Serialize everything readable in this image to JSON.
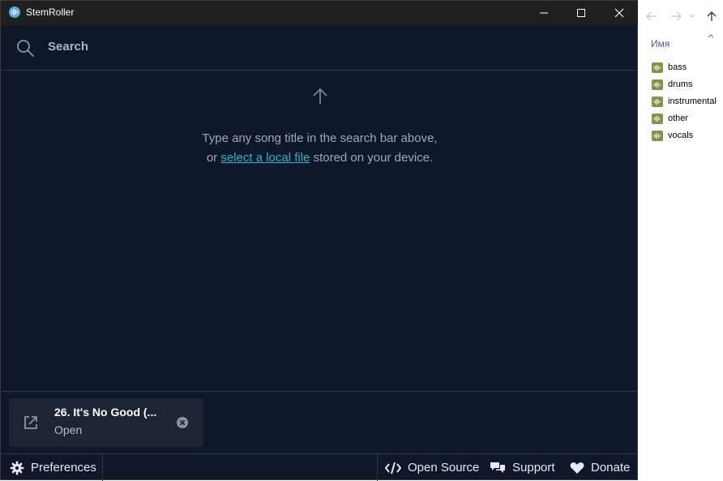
{
  "window": {
    "title": "StemRoller"
  },
  "search": {
    "label": "Search"
  },
  "hint": {
    "line1": "Type any song title in the search bar above,",
    "line2_prefix": "or ",
    "link": "select a local file",
    "line2_suffix": " stored on your device."
  },
  "recent": {
    "title": "26. It's No Good (...",
    "action": "Open"
  },
  "footer": {
    "preferences": "Preferences",
    "open_source": "Open Source",
    "support": "Support",
    "donate": "Donate"
  },
  "explorer": {
    "column_header": "Имя",
    "files": [
      "bass",
      "drums",
      "instrumental",
      "other",
      "vocals"
    ]
  },
  "colors": {
    "app_bg": "#0f172a",
    "titlebar": "#202020",
    "link": "#22b5d6",
    "card_bg": "#1d2433",
    "audio_file_icon": "#84934a"
  },
  "icons": {
    "app": "stemroller-logo-icon",
    "search": "search-icon",
    "up_arrow": "arrow-up-icon",
    "open_external": "open-external-icon",
    "remove": "close-circle-icon",
    "preferences": "gear-icon",
    "open_source": "code-icon",
    "support": "chat-icon",
    "donate": "heart-icon",
    "file": "audio-file-icon"
  }
}
